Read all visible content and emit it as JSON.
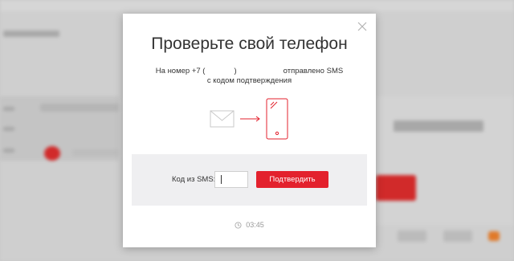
{
  "background": {
    "partial_title_left": "...",
    "partial_heading_right": "...",
    "description": "blurred underlying page"
  },
  "modal": {
    "title": "Проверьте свой телефон",
    "subtitle_line1_prefix": "На номер +7 (",
    "subtitle_line1_mid": ")",
    "subtitle_line1_suffix": "отправлено SMS",
    "subtitle_line2": "с кодом подтверждения",
    "illustration": {
      "envelope_icon": "envelope-icon",
      "arrow_icon": "arrow-right-icon",
      "phone_icon": "phone-icon"
    },
    "code_label": "Код из SMS:",
    "code_value": "",
    "confirm_label": "Подтвердить",
    "timer": "03:45",
    "accent_color": "#e3212d"
  }
}
